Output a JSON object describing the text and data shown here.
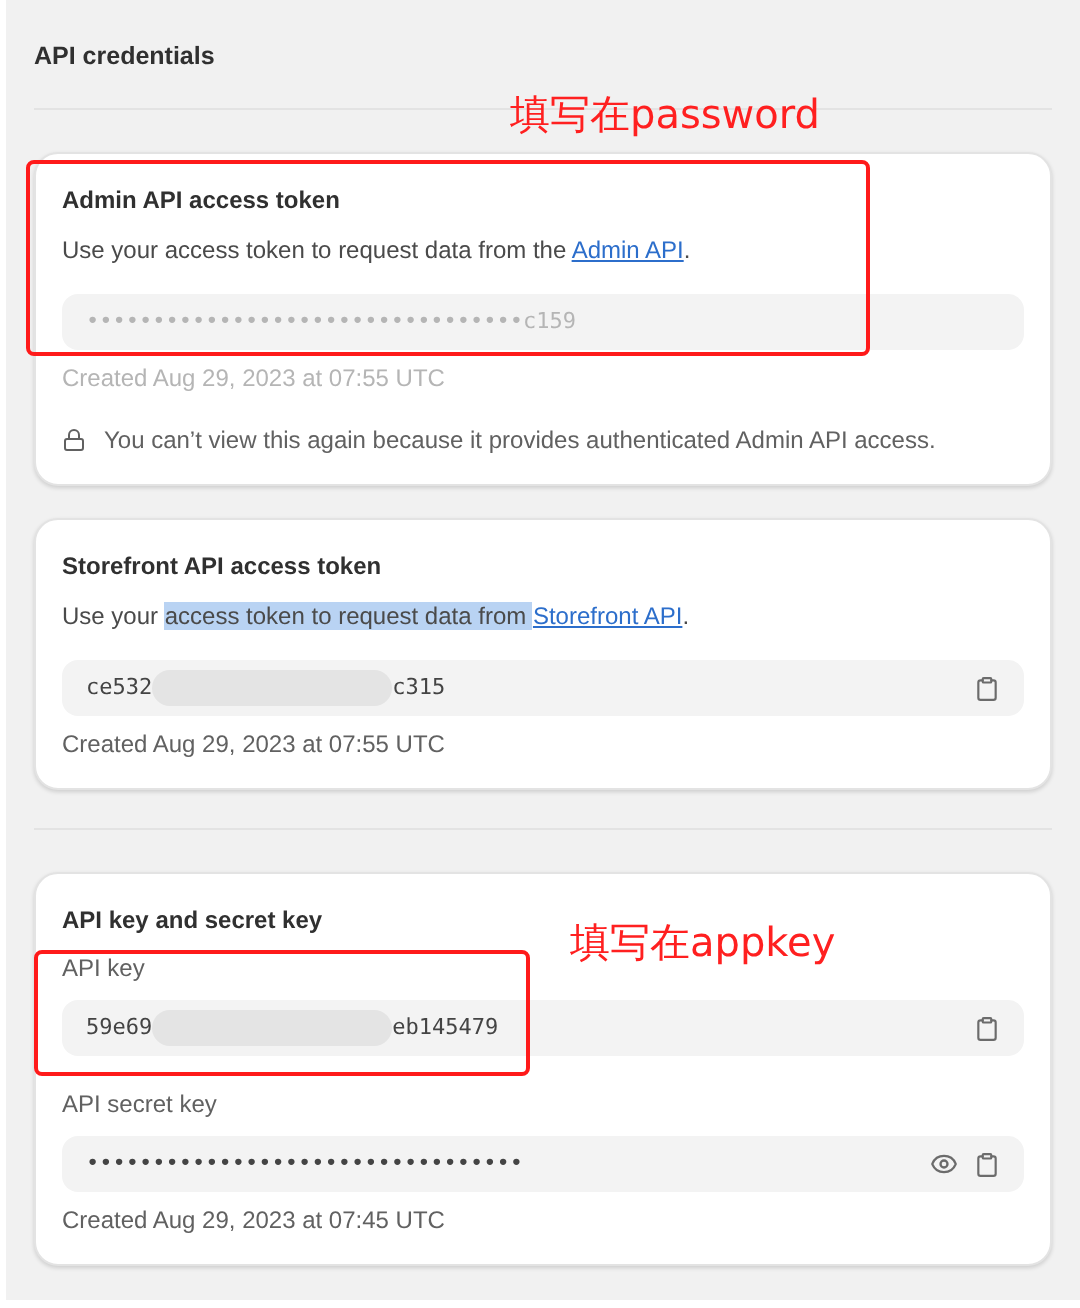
{
  "title": "API credentials",
  "annotations": [
    {
      "text": "填写在password"
    },
    {
      "text": "填写在appkey"
    }
  ],
  "sections": [
    {
      "cards": [
        {
          "title": "Admin API access token",
          "description": [
            {
              "kind": "text",
              "text": "Use your access token to request data from the ",
              "selected": false
            },
            {
              "kind": "link",
              "text": "Admin API",
              "selected": false
            },
            {
              "kind": "text",
              "text": ".",
              "selected": false
            }
          ],
          "fields": [
            {
              "value_start": "•••••••••••••••••••••••••••••••••c159",
              "redacted": false,
              "disabled": true,
              "copy_button": false,
              "show_button": false
            }
          ],
          "created": "Created Aug 29, 2023 at 07:55 UTC",
          "created_disabled": true,
          "note": "You can’t view this again because it provides authenticated Admin API access."
        },
        {
          "title": "Storefront API access token",
          "description": [
            {
              "kind": "text",
              "text": "Use your ",
              "selected": false
            },
            {
              "kind": "text",
              "text": "access token to request data from ",
              "selected": true
            },
            {
              "kind": "link",
              "text": "Storefront API",
              "selected": false
            },
            {
              "kind": "text",
              "text": ".",
              "selected": false
            }
          ],
          "fields": [
            {
              "value_start": "ce532",
              "redacted": true,
              "value_end": "c315",
              "disabled": false,
              "copy_button": true,
              "show_button": false
            }
          ],
          "created": "Created Aug 29, 2023 at 07:55 UTC",
          "created_disabled": false
        }
      ]
    },
    {
      "cards": [
        {
          "title": "API key and secret key",
          "fields": [
            {
              "label": "API key",
              "value_start": "59e69",
              "redacted": true,
              "value_end": "eb145479",
              "disabled": false,
              "copy_button": true,
              "show_button": false
            },
            {
              "label": "API secret key",
              "value_start": "•••••••••••••••••••••••••••••••••",
              "redacted": false,
              "disabled": false,
              "copy_button": true,
              "show_button": true
            }
          ],
          "created": "Created Aug 29, 2023 at 07:45 UTC",
          "created_disabled": false
        }
      ]
    }
  ]
}
